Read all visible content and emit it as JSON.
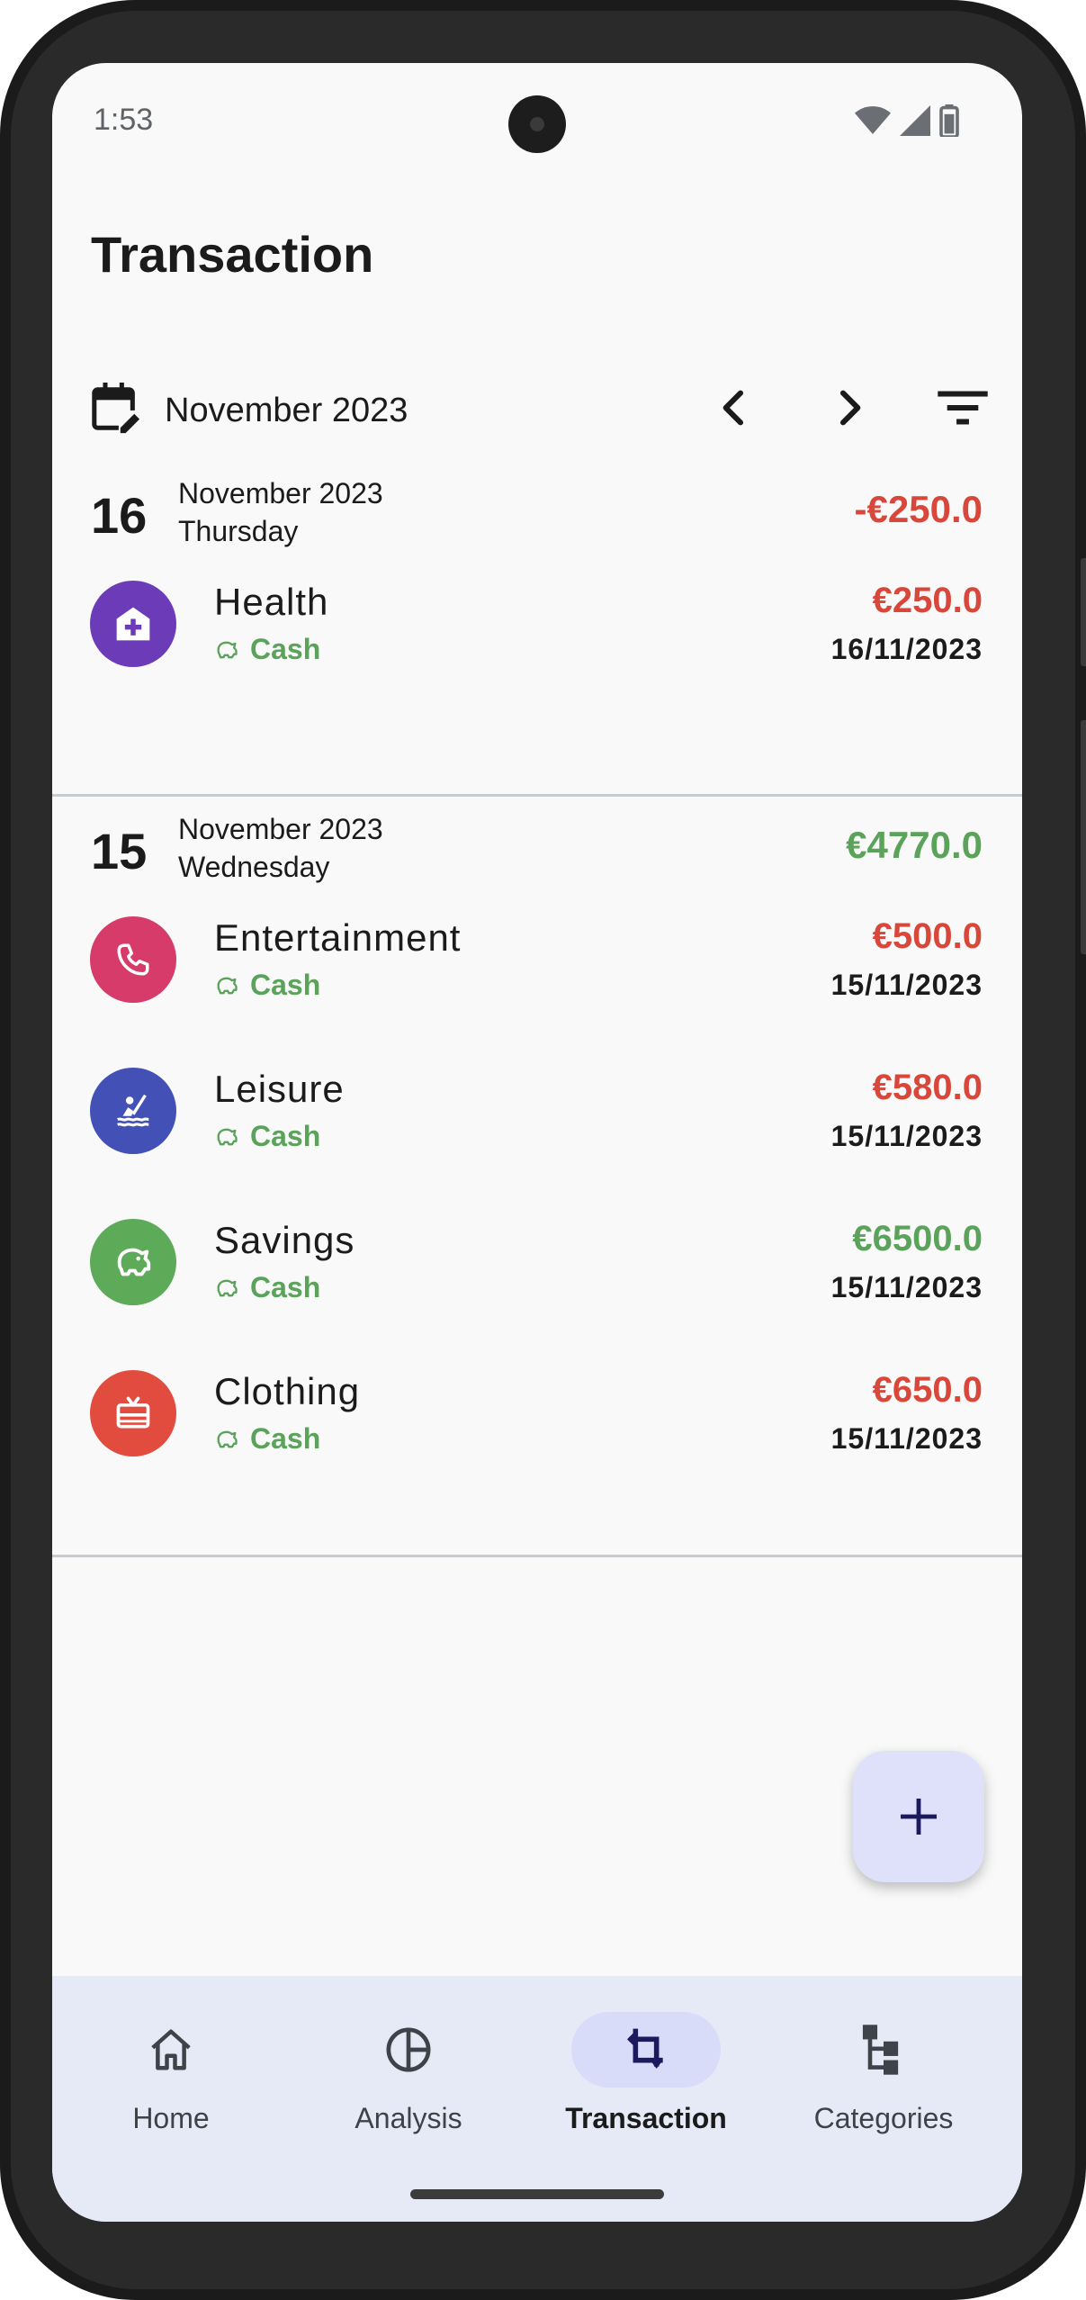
{
  "status_bar": {
    "time": "1:53"
  },
  "page": {
    "title": "Transaction"
  },
  "month_bar": {
    "label": "November 2023"
  },
  "colors": {
    "negative": "#d9473b",
    "positive": "#5ba35a",
    "accent": "#1b1a5c"
  },
  "day_groups": [
    {
      "day": "16",
      "month": "November 2023",
      "weekday": "Thursday",
      "total": "-€250.0",
      "total_sign": "negative",
      "transactions": [
        {
          "category": "Health",
          "account": "Cash",
          "amount": "€250.0",
          "sign": "negative",
          "date": "16/11/2023",
          "icon": "health-icon",
          "color": "#6b3bb8"
        }
      ]
    },
    {
      "day": "15",
      "month": "November 2023",
      "weekday": "Wednesday",
      "total": "€4770.0",
      "total_sign": "positive",
      "transactions": [
        {
          "category": "Entertainment",
          "account": "Cash",
          "amount": "€500.0",
          "sign": "negative",
          "date": "15/11/2023",
          "icon": "phone-icon",
          "color": "#d63b6a"
        },
        {
          "category": "Leisure",
          "account": "Cash",
          "amount": "€580.0",
          "sign": "negative",
          "date": "15/11/2023",
          "icon": "kayak-icon",
          "color": "#4350b5"
        },
        {
          "category": "Savings",
          "account": "Cash",
          "amount": "€6500.0",
          "sign": "positive",
          "date": "15/11/2023",
          "icon": "piggy-bank-icon",
          "color": "#5daa59"
        },
        {
          "category": "Clothing",
          "account": "Cash",
          "amount": "€650.0",
          "sign": "negative",
          "date": "15/11/2023",
          "icon": "gift-card-icon",
          "color": "#e14c3f"
        }
      ]
    }
  ],
  "bottom_nav": {
    "items": [
      {
        "label": "Home",
        "icon": "home-icon",
        "active": false
      },
      {
        "label": "Analysis",
        "icon": "pie-chart-icon",
        "active": false
      },
      {
        "label": "Transaction",
        "icon": "transaction-icon",
        "active": true
      },
      {
        "label": "Categories",
        "icon": "categories-icon",
        "active": false
      }
    ]
  }
}
